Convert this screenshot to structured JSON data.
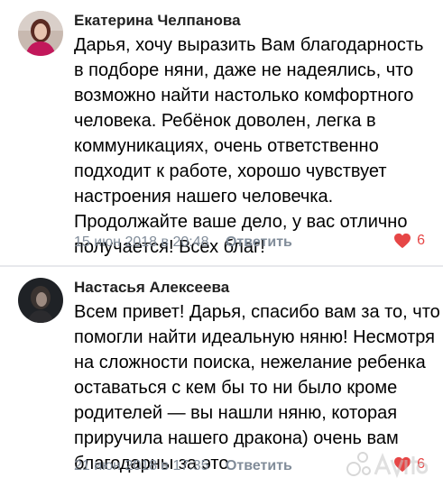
{
  "comments": [
    {
      "author": "Екатерина Челпанова",
      "text_lines": [
        "Дарья, хочу выразить Вам благодарность",
        "в подборе няни, даже не надеялись, что",
        "возможно найти настолько комфортного",
        "человека. Ребёнок доволен, легка в",
        "коммуникациях, очень ответственно",
        "подходит к работе, хорошо чувствует",
        "настроения нашего человечка.",
        "Продолжайте ваше дело, у вас отлично",
        "получается! Всех благ!"
      ],
      "date": "15 июн 2018 в 20:48",
      "reply_label": "Ответить",
      "likes": "6"
    },
    {
      "author": "Настасья Алексеева",
      "text_lines": [
        "Всем привет! Дарья, спасибо вам за то, что",
        "помогли найти идеальную няню! Несмотря",
        "на сложности поиска, нежелание ребенка",
        "оставаться с кем бы то ни было кроме",
        "родителей — вы нашли няню, которая",
        "приручила нашего дракона) очень вам",
        "благодарны за это"
      ],
      "date": "21 июн 2018 в 17:35",
      "reply_label": "Ответить",
      "likes": "6"
    }
  ],
  "colors": {
    "meta": "#818c99",
    "like_heart": "#e64646",
    "divider": "#e7e8ec"
  },
  "icons": {
    "like": "heart-icon",
    "watermark": "avito-watermark-icon"
  }
}
